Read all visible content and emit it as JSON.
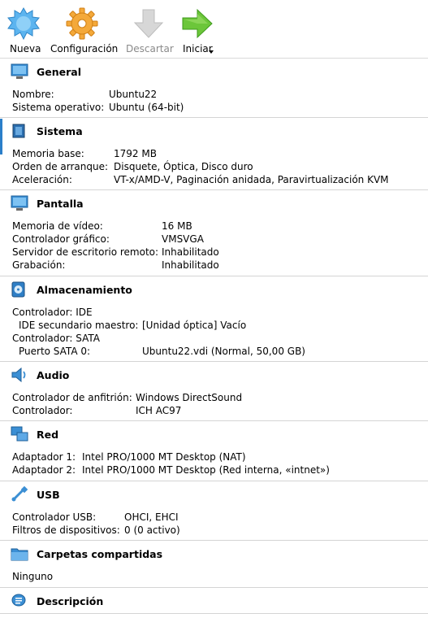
{
  "toolbar": {
    "new_label": "Nueva",
    "settings_label": "Configuración",
    "discard_label": "Descartar",
    "start_label": "Iniciar"
  },
  "sections": {
    "general": {
      "title": "General",
      "rows": [
        {
          "k": "Nombre:",
          "v": "Ubuntu22"
        },
        {
          "k": "Sistema operativo:",
          "v": "Ubuntu (64-bit)"
        }
      ]
    },
    "system": {
      "title": "Sistema",
      "rows": [
        {
          "k": "Memoria base:",
          "v": "1792 MB"
        },
        {
          "k": "Orden de arranque:",
          "v": "Disquete, Óptica, Disco duro"
        },
        {
          "k": "Aceleración:",
          "v": "VT-x/AMD-V, Paginación anidada, Paravirtualización KVM"
        }
      ]
    },
    "display": {
      "title": "Pantalla",
      "rows": [
        {
          "k": "Memoria de vídeo:",
          "v": "16 MB"
        },
        {
          "k": "Controlador gráfico:",
          "v": "VMSVGA"
        },
        {
          "k": "Servidor de escritorio remoto:",
          "v": "Inhabilitado"
        },
        {
          "k": "Grabación:",
          "v": "Inhabilitado"
        }
      ]
    },
    "storage": {
      "title": "Almacenamiento",
      "rows": [
        {
          "k": "Controlador: IDE",
          "v": ""
        },
        {
          "k": "IDE secundario maestro:",
          "v": "[Unidad óptica] Vacío"
        },
        {
          "k": "Controlador: SATA",
          "v": ""
        },
        {
          "k": "Puerto SATA 0:",
          "v": "Ubuntu22.vdi (Normal, 50,00 GB)"
        }
      ]
    },
    "audio": {
      "title": "Audio",
      "rows": [
        {
          "k": "Controlador de anfitrión:",
          "v": "Windows DirectSound"
        },
        {
          "k": "Controlador:",
          "v": "ICH AC97"
        }
      ]
    },
    "network": {
      "title": "Red",
      "rows": [
        {
          "k": "Adaptador 1:",
          "v": "Intel PRO/1000 MT Desktop (NAT)"
        },
        {
          "k": "Adaptador 2:",
          "v": "Intel PRO/1000 MT Desktop (Red interna, «intnet»)"
        }
      ]
    },
    "usb": {
      "title": "USB",
      "rows": [
        {
          "k": "Controlador USB:",
          "v": "OHCI, EHCI"
        },
        {
          "k": "Filtros de dispositivos:",
          "v": "0 (0 activo)"
        }
      ]
    },
    "shared": {
      "title": "Carpetas compartidas",
      "rows": [
        {
          "k": "Ninguno",
          "v": ""
        }
      ]
    },
    "description": {
      "title": "Descripción"
    }
  }
}
